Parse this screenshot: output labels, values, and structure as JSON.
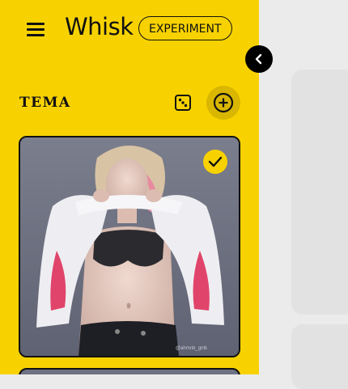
{
  "app": {
    "title": "Whisk",
    "badge": "EXPERIMENT"
  },
  "sidebar": {
    "section_title": "TEMA",
    "icons": {
      "menu": "menu-icon",
      "randomize": "dice-icon",
      "add": "add-circle-icon",
      "collapse": "chevron-left-icon",
      "selected": "check-icon"
    },
    "image_card": {
      "selected": true,
      "watermark": "@ahmnb_gntk"
    }
  },
  "colors": {
    "sidebar_bg": "#f7d200",
    "canvas_bg": "#ebebeb",
    "panel_bg": "#e2e2e2",
    "accent_dark": "#111111"
  }
}
